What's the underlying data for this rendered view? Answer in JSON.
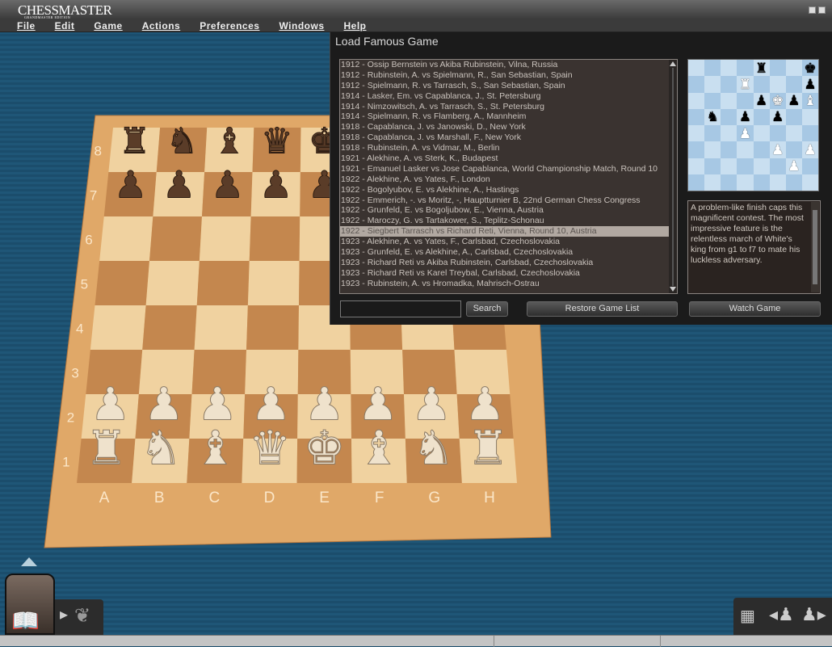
{
  "app": {
    "logo": "CHESSMASTER",
    "logo_sub": "GRANDMASTER EDITION"
  },
  "menu": [
    "File",
    "Edit",
    "Game",
    "Actions",
    "Preferences",
    "Windows",
    "Help"
  ],
  "board": {
    "files": [
      "A",
      "B",
      "C",
      "D",
      "E",
      "F",
      "G",
      "H"
    ],
    "ranks": [
      "1",
      "2",
      "3",
      "4",
      "5",
      "6",
      "7",
      "8"
    ],
    "light": "#f0d2a0",
    "dark": "#c4874e",
    "frame": "#e0a868",
    "position": [
      "rnbqkbnr",
      "pppppppp",
      "........",
      "........",
      "........",
      "........",
      "PPPPPPPP",
      "RNBQKBNR"
    ]
  },
  "dialog": {
    "title": "Load Famous Game",
    "games": [
      "1912 - Ossip Bernstein vs Akiba Rubinstein, Vilna, Russia",
      "1912 - Rubinstein, A. vs Spielmann, R., San Sebastian, Spain",
      "1912 - Spielmann, R. vs Tarrasch, S., San Sebastian, Spain",
      "1914 - Lasker, Em. vs Capablanca, J., St. Petersburg",
      "1914 - Nimzowitsch, A. vs Tarrasch, S., St. Petersburg",
      "1914 - Spielmann, R. vs Flamberg, A., Mannheim",
      "1918 - Capablanca, J. vs Janowski, D., New York",
      "1918 - Capablanca, J. vs Marshall, F., New York",
      "1918 - Rubinstein, A. vs Vidmar, M., Berlin",
      "1921 - Alekhine, A. vs Sterk, K., Budapest",
      "1921 - Emanuel Lasker vs Jose Capablanca, World Championship Match, Round 10",
      "1922 - Alekhine, A. vs Yates, F., London",
      "1922 - Bogolyubov, E. vs Alekhine, A., Hastings",
      "1922 - Emmerich, -. vs Moritz, -, Hauptturnier B, 22nd German Chess Congress",
      "1922 - Grunfeld, E. vs Bogoljubow, E., Vienna, Austria",
      "1922 - Maroczy, G. vs Tartakower, S., Teplitz-Schonau",
      "1922 - Siegbert Tarrasch vs Richard Reti, Vienna, Round 10, Austria",
      "1923 - Alekhine, A. vs Yates, F., Carlsbad, Czechoslovakia",
      "1923 - Grunfeld, E. vs Alekhine, A., Carlsbad, Czechoslovakia",
      "1923 - Richard Reti vs Akiba Rubinstein, Carlsbad, Czechoslovakia",
      "1923 - Richard Reti vs Karel Treybal, Carlsbad, Czechoslovakia",
      "1923 - Rubinstein, A. vs Hromadka, Mahrisch-Ostrau"
    ],
    "selected_index": 16,
    "preview_position": [
      "....r..k",
      "...R...p",
      "....pKpB",
      ".n.p.p..",
      "...P....",
      ".....P.P",
      "......P.",
      "........"
    ],
    "description": "A problem-like finish caps this magnificent contest. The most impressive feature is the relentless march of White's king from g1 to f7 to mate his luckless adversary.",
    "search_value": "",
    "search_label": "Search",
    "restore_label": "Restore Game List",
    "watch_label": "Watch Game"
  },
  "tray": {
    "left_icons": [
      "book-icon",
      "play-arrow-icon",
      "laurel-icon"
    ],
    "right_icons": [
      "board-icon",
      "previous-piece-icon",
      "next-piece-icon"
    ]
  }
}
